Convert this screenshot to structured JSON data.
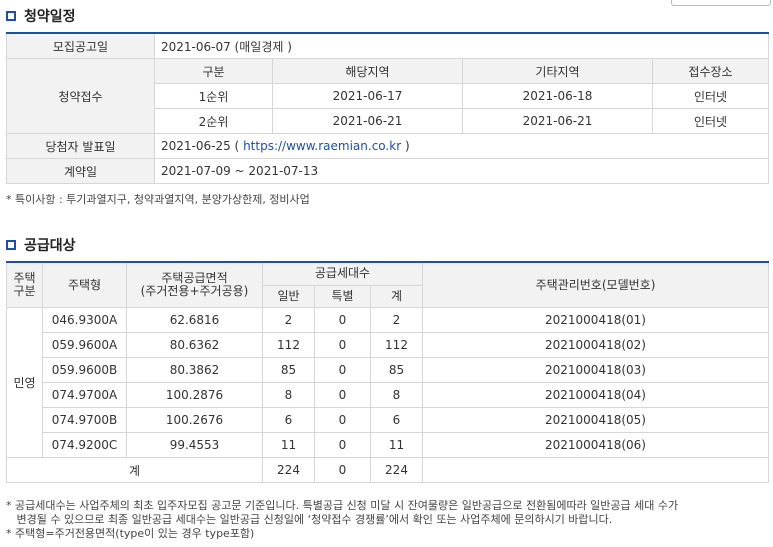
{
  "schedule": {
    "title": "청약일정",
    "notice_label": "모집공고일",
    "notice_value": "2021-06-07 (매일경제 )",
    "apply_label": "청약접수",
    "apply_headers": [
      "구분",
      "해당지역",
      "기타지역",
      "접수장소"
    ],
    "apply_rows": [
      [
        "1순위",
        "2021-06-17",
        "2021-06-18",
        "인터넷"
      ],
      [
        "2순위",
        "2021-06-21",
        "2021-06-21",
        "인터넷"
      ]
    ],
    "winner_label": "당첨자 발표일",
    "winner_date": "2021-06-25 ( ",
    "winner_link": "https://www.raemian.co.kr",
    "winner_close": " )",
    "contract_label": "계약일",
    "contract_value": "2021-07-09 ~ 2021-07-13",
    "special_note": "* 특이사항 : 투기과열지구, 청약과열지역, 분양가상한제, 정비사업"
  },
  "supply": {
    "title": "공급대상",
    "headers": {
      "type_group_1": "주택",
      "type_group_2": "구분",
      "house_type": "주택형",
      "area_1": "주택공급면적",
      "area_2": "(주거전용+주거공용)",
      "units": "공급세대수",
      "general": "일반",
      "special": "특별",
      "total": "계",
      "model_no": "주택관리번호(모델번호)"
    },
    "group_label": "민영",
    "rows": [
      [
        "046.9300A",
        "62.6816",
        "2",
        "0",
        "2",
        "2021000418(01)"
      ],
      [
        "059.9600A",
        "80.6362",
        "112",
        "0",
        "112",
        "2021000418(02)"
      ],
      [
        "059.9600B",
        "80.3862",
        "85",
        "0",
        "85",
        "2021000418(03)"
      ],
      [
        "074.9700A",
        "100.2876",
        "8",
        "0",
        "8",
        "2021000418(04)"
      ],
      [
        "074.9700B",
        "100.2676",
        "6",
        "0",
        "6",
        "2021000418(05)"
      ],
      [
        "074.9200C",
        "99.4553",
        "11",
        "0",
        "11",
        "2021000418(06)"
      ]
    ],
    "total_row": {
      "label": "계",
      "general": "224",
      "special": "0",
      "total": "224"
    },
    "notes": [
      "* 공급세대수는 사업주체의 최초 입주자모집 공고문 기준입니다. 특별공급 신청 미달 시 잔여물량은 일반공급으로 전환됨에따라 일반공급 세대 수가",
      "   변경될 수 있으므로 최종 일반공급 세대수는 일반공급 신청일에 ‘청약접수 경쟁률’에서 확인 또는 사업주체에 문의하시기 바랍니다.",
      "* 주택형=주거전용면적(type이 있는 경우 type포함)"
    ]
  }
}
